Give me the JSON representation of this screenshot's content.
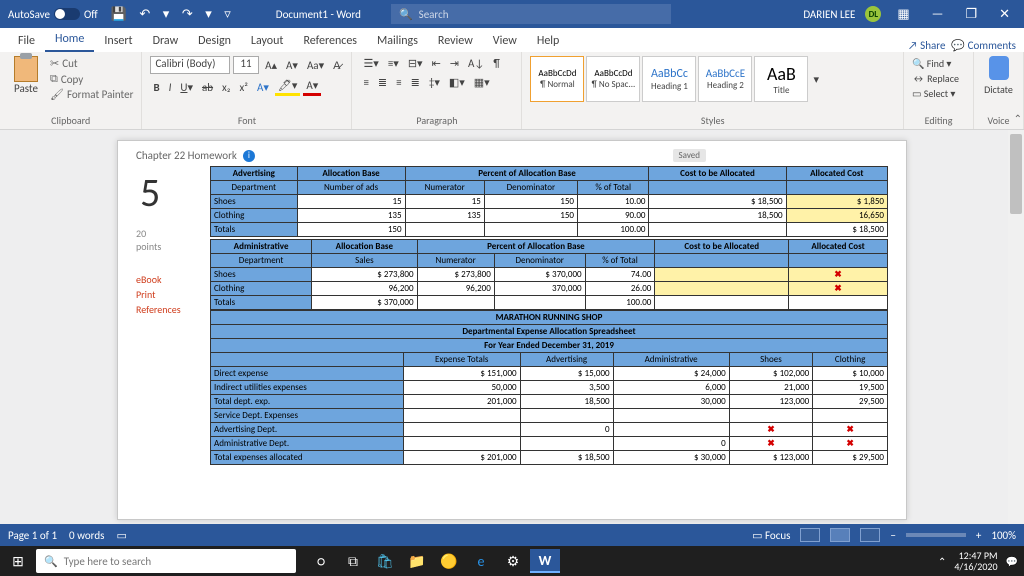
{
  "titlebar": {
    "autosave_label": "AutoSave",
    "autosave_state": "Off",
    "doc_title": "Document1 - Word",
    "search_placeholder": "Search",
    "user_name": "DARIEN LEE",
    "user_initials": "DL"
  },
  "menutabs": {
    "items": [
      "File",
      "Home",
      "Insert",
      "Draw",
      "Design",
      "Layout",
      "References",
      "Mailings",
      "Review",
      "View",
      "Help"
    ],
    "active": "Home",
    "share": "Share",
    "comments": "Comments"
  },
  "ribbon": {
    "clipboard": {
      "label": "Clipboard",
      "paste": "Paste",
      "cut": "Cut",
      "copy": "Copy",
      "format_painter": "Format Painter"
    },
    "font": {
      "label": "Font",
      "family": "Calibri (Body)",
      "size": "11"
    },
    "paragraph": {
      "label": "Paragraph"
    },
    "styles": {
      "label": "Styles",
      "items": [
        {
          "sample": "AaBbCcDd",
          "name": "¶ Normal"
        },
        {
          "sample": "AaBbCcDd",
          "name": "¶ No Spac..."
        },
        {
          "sample": "AaBbCc",
          "name": "Heading 1"
        },
        {
          "sample": "AaBbCcE",
          "name": "Heading 2"
        },
        {
          "sample": "AaB",
          "name": "Title"
        }
      ]
    },
    "editing": {
      "label": "Editing",
      "find": "Find",
      "replace": "Replace",
      "select": "Select"
    },
    "voice": {
      "label": "Voice",
      "dictate": "Dictate"
    }
  },
  "document": {
    "header_title": "Chapter 22 Homework",
    "saved_badge": "Saved",
    "question_number": "5",
    "points_num": "20",
    "points_label": "points",
    "side_links": [
      "eBook",
      "Print",
      "References"
    ]
  },
  "sheet": {
    "adv": {
      "section": "Advertising",
      "alloc_base": "Allocation Base",
      "pct_base": "Percent of Allocation Base",
      "cost_to_be": "Cost to be Allocated",
      "alloc_cost": "Allocated Cost",
      "cols": [
        "Department",
        "Number of ads",
        "Numerator",
        "Denominator",
        "% of Total",
        "",
        ""
      ],
      "rows": [
        {
          "dept": "Shoes",
          "base": "15",
          "num": "15",
          "den": "150",
          "pct": "10.00",
          "cost": "$   18,500",
          "alloc": "$       1,850",
          "hl_alloc": true
        },
        {
          "dept": "Clothing",
          "base": "135",
          "num": "135",
          "den": "150",
          "pct": "90.00",
          "cost": "18,500",
          "alloc": "16,650",
          "hl_alloc": true
        }
      ],
      "tot": {
        "label": "Totals",
        "base": "150",
        "pct": "100.00",
        "alloc": "$     18,500"
      }
    },
    "admin": {
      "section": "Administrative",
      "alloc_base": "Allocation Base",
      "pct_base": "Percent of Allocation Base",
      "cost_to_be": "Cost to be Allocated",
      "alloc_cost": "Allocated Cost",
      "cols": [
        "Department",
        "Sales",
        "Numerator",
        "Denominator",
        "% of Total",
        "",
        ""
      ],
      "rows": [
        {
          "dept": "Shoes",
          "base": "$          273,800",
          "num": "$   273,800",
          "den": "$      370,000",
          "pct": "74.00",
          "cost": "",
          "alloc": "✖",
          "hl": true
        },
        {
          "dept": "Clothing",
          "base": "96,200",
          "num": "96,200",
          "den": "370,000",
          "pct": "26.00",
          "cost": "",
          "alloc": "✖",
          "hl": true
        }
      ],
      "tot": {
        "label": "Totals",
        "base": "$          370,000",
        "pct": "100.00"
      }
    },
    "band": {
      "l1": "MARATHON RUNNING SHOP",
      "l2": "Departmental Expense Allocation Spreadsheet",
      "l3": "For Year Ended December 31, 2019"
    },
    "exp": {
      "cols": [
        "",
        "Expense Totals",
        "Advertising",
        "Administrative",
        "Shoes",
        "Clothing"
      ],
      "rows": [
        [
          "Direct expense",
          "$          151,000",
          "$     15,000",
          "$        24,000",
          "$  102,000",
          "$   10,000"
        ],
        [
          "Indirect utilities expenses",
          "50,000",
          "3,500",
          "6,000",
          "21,000",
          "19,500"
        ],
        [
          "Total dept. exp.",
          "201,000",
          "18,500",
          "30,000",
          "123,000",
          "29,500"
        ],
        [
          "Service Dept. Expenses",
          "",
          "",
          "",
          "",
          ""
        ],
        [
          "Advertising Dept.",
          "",
          "0",
          "",
          "✖",
          "✖"
        ],
        [
          "Administrative Dept.",
          "",
          "",
          "0",
          "✖",
          "✖"
        ],
        [
          "Total expenses allocated",
          "$          201,000",
          "$     18,500",
          "$        30,000",
          "$  123,000",
          "$   29,500"
        ]
      ]
    }
  },
  "statusbar": {
    "page": "Page 1 of 1",
    "words": "0 words",
    "focus": "Focus",
    "zoom": "100%"
  },
  "taskbar": {
    "search_placeholder": "Type here to search",
    "time": "12:47 PM",
    "date": "4/16/2020"
  }
}
